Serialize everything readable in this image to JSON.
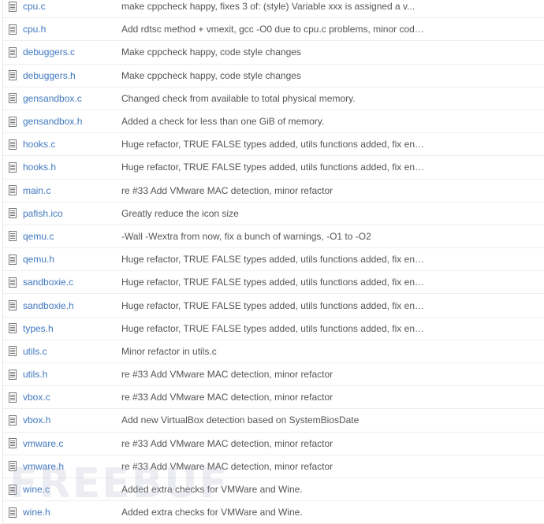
{
  "colors": {
    "link": "#4078c0",
    "message": "#555555",
    "row_border": "#eeeeee",
    "icon": "#777777"
  },
  "watermark_text": "FREEBUF",
  "files": [
    {
      "name": "cpu.c",
      "message": "make cppcheck happy, fixes 3 of: (style) Variable xxx is assigned a v...",
      "icon": "file-icon"
    },
    {
      "name": "cpu.h",
      "message": "Add rdtsc method + vmexit, gcc -O0 due to cpu.c problems, minor code ...",
      "icon": "file-icon"
    },
    {
      "name": "debuggers.c",
      "message": "Make cppcheck happy, code style changes",
      "icon": "file-icon"
    },
    {
      "name": "debuggers.h",
      "message": "Make cppcheck happy, code style changes",
      "icon": "file-icon"
    },
    {
      "name": "gensandbox.c",
      "message": "Changed check from available to total physical memory.",
      "icon": "file-icon"
    },
    {
      "name": "gensandbox.h",
      "message": "Added a check for less than one GiB of memory.",
      "icon": "file-icon"
    },
    {
      "name": "hooks.c",
      "message": "Huge refactor, TRUE FALSE types added, utils functions added, fix enc...",
      "icon": "file-icon"
    },
    {
      "name": "hooks.h",
      "message": "Huge refactor, TRUE FALSE types added, utils functions added, fix enc...",
      "icon": "file-icon"
    },
    {
      "name": "main.c",
      "message": "re #33 Add VMware MAC detection, minor refactor",
      "icon": "file-icon"
    },
    {
      "name": "pafish.ico",
      "message": "Greatly reduce the icon size",
      "icon": "file-icon"
    },
    {
      "name": "qemu.c",
      "message": "-Wall -Wextra from now, fix a bunch of warnings, -O1 to -O2",
      "icon": "file-icon"
    },
    {
      "name": "qemu.h",
      "message": "Huge refactor, TRUE FALSE types added, utils functions added, fix enc...",
      "icon": "file-icon"
    },
    {
      "name": "sandboxie.c",
      "message": "Huge refactor, TRUE FALSE types added, utils functions added, fix enc...",
      "icon": "file-icon"
    },
    {
      "name": "sandboxie.h",
      "message": "Huge refactor, TRUE FALSE types added, utils functions added, fix enc...",
      "icon": "file-icon"
    },
    {
      "name": "types.h",
      "message": "Huge refactor, TRUE FALSE types added, utils functions added, fix enc...",
      "icon": "file-icon"
    },
    {
      "name": "utils.c",
      "message": "Minor refactor in utils.c",
      "icon": "file-icon"
    },
    {
      "name": "utils.h",
      "message": "re #33 Add VMware MAC detection, minor refactor",
      "icon": "file-icon"
    },
    {
      "name": "vbox.c",
      "message": "re #33 Add VMware MAC detection, minor refactor",
      "icon": "file-icon"
    },
    {
      "name": "vbox.h",
      "message": "Add new VirtualBox detection based on SystemBiosDate",
      "icon": "file-icon"
    },
    {
      "name": "vmware.c",
      "message": "re #33 Add VMware MAC detection, minor refactor",
      "icon": "file-icon"
    },
    {
      "name": "vmware.h",
      "message": "re #33 Add VMware MAC detection, minor refactor",
      "icon": "file-icon"
    },
    {
      "name": "wine.c",
      "message": "Added extra checks for VMWare and Wine.",
      "icon": "file-icon"
    },
    {
      "name": "wine.h",
      "message": "Added extra checks for VMWare and Wine.",
      "icon": "file-icon"
    }
  ]
}
